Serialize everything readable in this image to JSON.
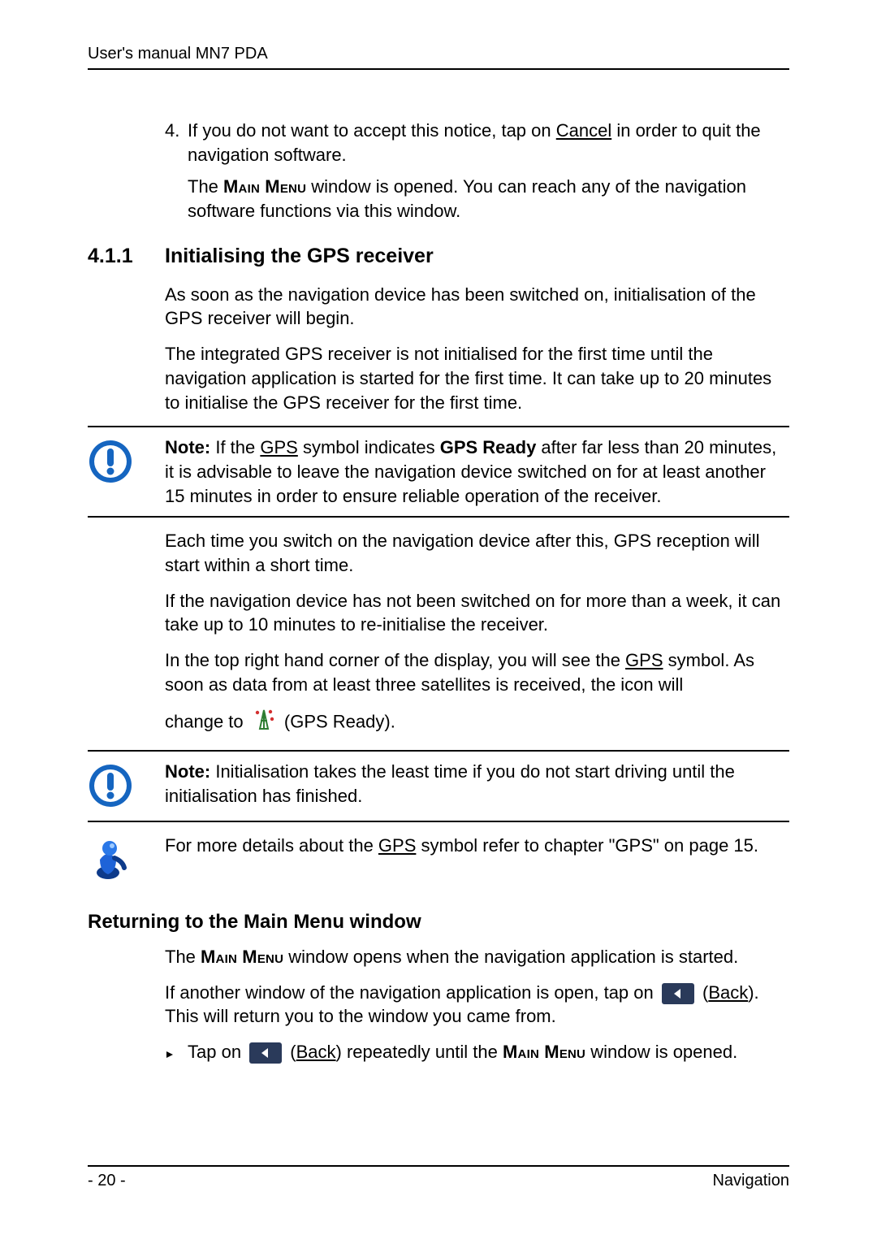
{
  "header": {
    "text": "User's manual MN7 PDA"
  },
  "footer": {
    "page": "- 20 -",
    "chapter": "Navigation"
  },
  "step4": {
    "num": "4.",
    "line1_a": "If you do not want to accept this notice, tap on ",
    "line1_cancel": "Cancel",
    "line1_b": " in order to quit the navigation software.",
    "line2_a": "The ",
    "line2_mm": "Main Menu",
    "line2_b": " window is opened. You can reach any of the navigation software functions via this window."
  },
  "sec": {
    "num": "4.1.1",
    "title": "Initialising the GPS receiver",
    "p1": "As soon as the navigation device has been switched on, initialisation of the GPS receiver will begin.",
    "p2": "The integrated GPS receiver is not initialised for the first time until the navigation application is started for the first time. It can take up to 20 minutes to initialise the GPS receiver for the first time."
  },
  "note1": {
    "lead": "Note:",
    "a": " If the ",
    "gps": "GPS",
    "b": " symbol indicates ",
    "ready": "GPS Ready",
    "c": " after far less than 20 minutes, it is advisable to leave the navigation device switched on for at least another 15 minutes in order to ensure reliable operation of the receiver."
  },
  "after": {
    "p3": "Each time you switch on the navigation device after this, GPS reception will start within a short time.",
    "p4": "If the navigation device has not been switched on for more than a week, it can take up to 10 minutes to re-initialise the receiver.",
    "p5_a": "In the top right hand corner of the display, you will see the ",
    "p5_gps": "GPS",
    "p5_b": " symbol. As soon as data from at least three satellites is received, the icon will",
    "p6_a": "change to ",
    "p6_b": " (GPS Ready)."
  },
  "note2": {
    "lead": "Note:",
    "text": " Initialisation takes the least time if you do not start driving until the initialisation has finished."
  },
  "info": {
    "a": "For more details about the ",
    "gps": "GPS",
    "b": " symbol refer to chapter \"GPS\" on page 15."
  },
  "sub": {
    "title": "Returning to the Main Menu window",
    "p1_a": "The ",
    "p1_mm": "Main Menu",
    "p1_b": " window opens when the navigation application is started.",
    "p2_a": "If another window of the navigation application is open, tap on ",
    "p2_b": " (",
    "p2_back": "Back",
    "p2_c": "). This will return you to the window you came from.",
    "bullet_a": "Tap on ",
    "bullet_b": " (",
    "bullet_back": "Back",
    "bullet_c": ") repeatedly until the ",
    "bullet_mm": "Main Menu",
    "bullet_d": " window is opened."
  }
}
